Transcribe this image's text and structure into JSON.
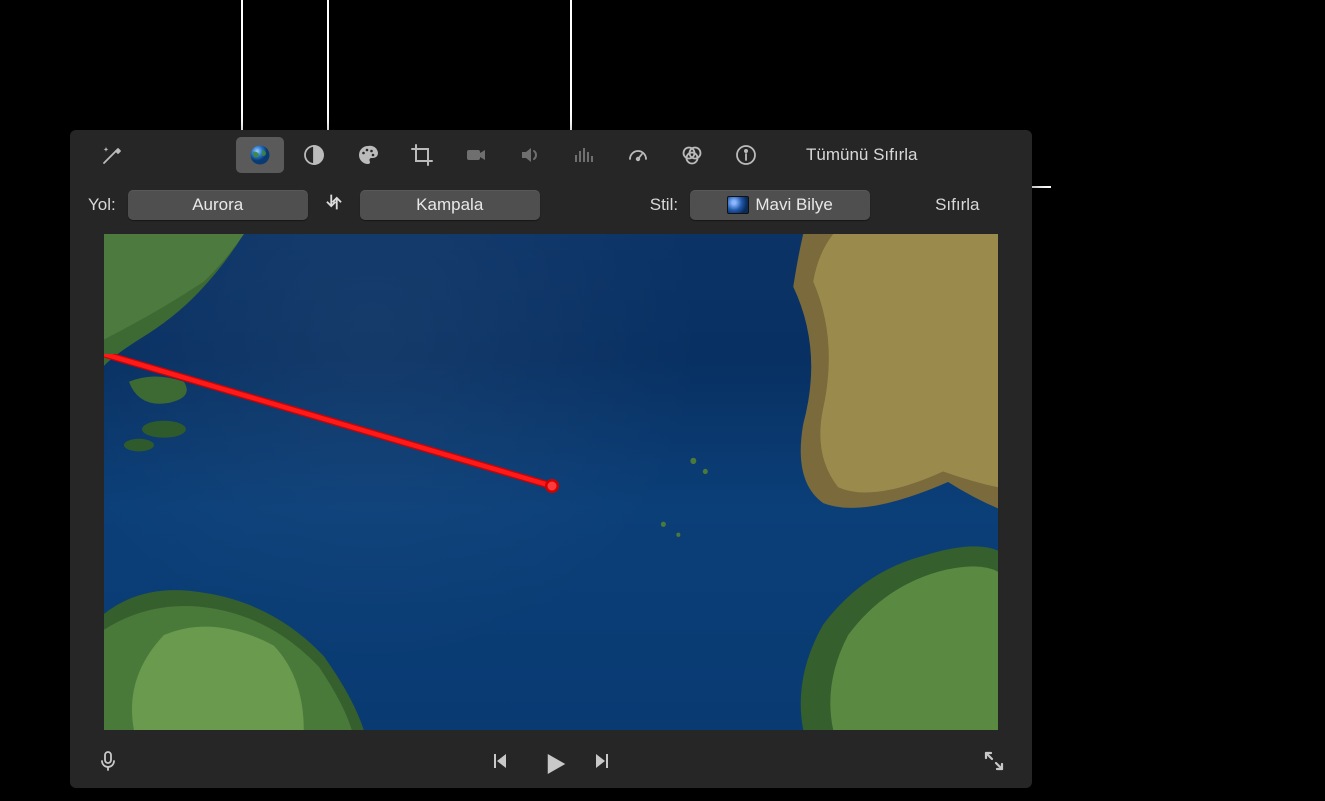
{
  "toolbar": {
    "reset_all_label": "Tümünü Sıfırla"
  },
  "controls": {
    "path_label": "Yol:",
    "origin_value": "Aurora",
    "destination_value": "Kampala",
    "style_label": "Stil:",
    "style_value": "Mavi Bilye",
    "reset_label": "Sıfırla"
  },
  "icons": {
    "wand": "magic-wand",
    "globe": "globe",
    "contrast": "contrast",
    "palette": "palette",
    "crop": "crop",
    "camera": "camera",
    "volume": "volume",
    "eq": "equalizer",
    "speed": "speedometer",
    "filters": "overlapping-circles",
    "info": "info"
  }
}
